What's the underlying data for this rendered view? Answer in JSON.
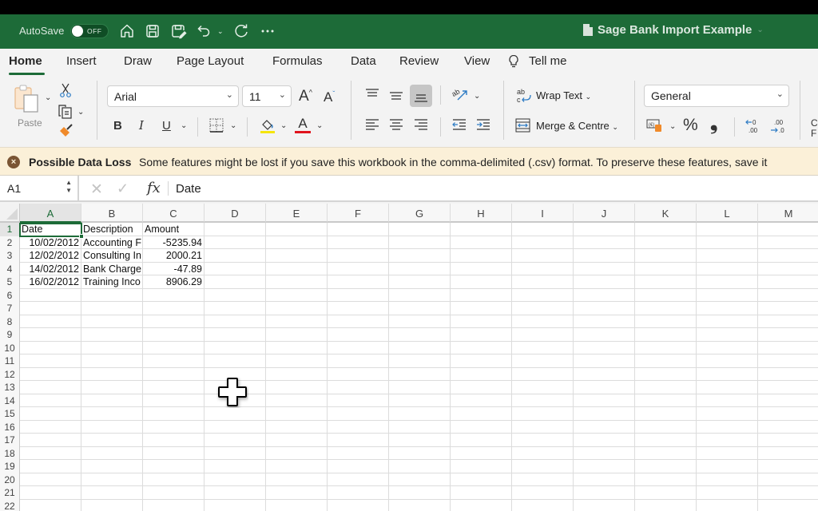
{
  "titlebar": {
    "autosave_label": "AutoSave",
    "autosave_state": "OFF",
    "icons": [
      "home-icon",
      "save-icon",
      "save-as-icon",
      "undo-icon",
      "redo-icon",
      "more-icon"
    ],
    "document_title": "Sage Bank Import Example"
  },
  "tabs": [
    {
      "label": "Home",
      "active": true
    },
    {
      "label": "Insert"
    },
    {
      "label": "Draw"
    },
    {
      "label": "Page Layout"
    },
    {
      "label": "Formulas"
    },
    {
      "label": "Data"
    },
    {
      "label": "Review"
    },
    {
      "label": "View"
    },
    {
      "label": "Tell me"
    }
  ],
  "ribbon": {
    "paste_label": "Paste",
    "font_name": "Arial",
    "font_size": "11",
    "bold": "B",
    "italic": "I",
    "underline": "U",
    "font_color_letter": "A",
    "wrap_text_label": "Wrap Text",
    "merge_label": "Merge & Centre",
    "number_format": "General",
    "percent": "%",
    "comma": "❟",
    "partial_label_1": "C",
    "partial_label_2": "F",
    "colors": {
      "highlight": "#f5e50c",
      "font_color": "#e0141e",
      "accent": "#1d6b38"
    }
  },
  "warning": {
    "title": "Possible Data Loss",
    "message": "Some features might be lost if you save this workbook in the comma-delimited (.csv) format. To preserve these features, save it"
  },
  "formula_bar": {
    "name_box": "A1",
    "fx": "fx",
    "content": "Date"
  },
  "sheet": {
    "columns": [
      "A",
      "B",
      "C",
      "D",
      "E",
      "F",
      "G",
      "H",
      "I",
      "J",
      "K",
      "L",
      "M"
    ],
    "rows": [
      "1",
      "2",
      "3",
      "4",
      "5",
      "6",
      "7",
      "8",
      "9",
      "10",
      "11",
      "12",
      "13",
      "14",
      "15",
      "16",
      "17",
      "18",
      "19",
      "20",
      "21",
      "22"
    ],
    "selected_cell": "A1",
    "data": [
      [
        "Date",
        "Description",
        "Amount"
      ],
      [
        "10/02/2012",
        "Accounting F",
        "-5235.94"
      ],
      [
        "12/02/2012",
        "Consulting In",
        "2000.21"
      ],
      [
        "14/02/2012",
        "Bank Charge",
        "-47.89"
      ],
      [
        "16/02/2012",
        "Training Inco",
        "8906.29"
      ]
    ]
  }
}
